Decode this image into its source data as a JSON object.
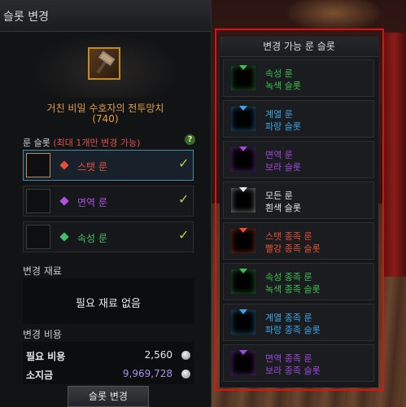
{
  "window": {
    "title": "슬롯 변경"
  },
  "item": {
    "name": "거친 비밀 수호자의 전투망치",
    "level": "(740)"
  },
  "rune_slots": {
    "header": "룬 슬롯",
    "note": "(최대 1개만 변경 가능)",
    "help": "?",
    "slots": [
      {
        "label": "스탯 룬",
        "color": "#e0503a",
        "checked": "✓",
        "selected": true
      },
      {
        "label": "면역 룬",
        "color": "#b050e0",
        "checked": "✓",
        "selected": false
      },
      {
        "label": "속성 룬",
        "color": "#40c060",
        "checked": "✓",
        "selected": false
      }
    ]
  },
  "materials": {
    "label": "변경 재료",
    "empty_text": "필요 재료 없음"
  },
  "cost": {
    "label": "변경 비용",
    "required_label": "필요 비용",
    "required_value": "2,560",
    "owned_label": "소지금",
    "owned_value": "9,969,728"
  },
  "change_button": "슬롯 변경",
  "available": {
    "title": "변경 가능 룬 슬롯",
    "runes": [
      {
        "name": "속성 룬",
        "slot": "녹색 슬롯",
        "color": "#3ec050",
        "icon": "green-rune-icon"
      },
      {
        "name": "계열 룬",
        "slot": "파랑 슬롯",
        "color": "#3aa8e8",
        "icon": "blue-rune-icon"
      },
      {
        "name": "면역 룬",
        "slot": "보라 슬롯",
        "color": "#a048e0",
        "icon": "purple-rune-icon"
      },
      {
        "name": "모든 룬",
        "slot": "흰색 슬롯",
        "color": "#e8e8e8",
        "icon": "white-rune-icon"
      },
      {
        "name": "스탯 종족 룬",
        "slot": "빨강 종족 슬롯",
        "color": "#e85030",
        "icon": "red-rune-icon"
      },
      {
        "name": "속성 종족 룬",
        "slot": "녹색 종족 슬롯",
        "color": "#3ec050",
        "icon": "green-rune-icon"
      },
      {
        "name": "계열 종족 룬",
        "slot": "파랑 종족 슬롯",
        "color": "#3aa8e8",
        "icon": "blue-rune-icon"
      },
      {
        "name": "면역 종족 룬",
        "slot": "보라 종족 슬롯",
        "color": "#a048e0",
        "icon": "purple-rune-icon"
      }
    ]
  }
}
